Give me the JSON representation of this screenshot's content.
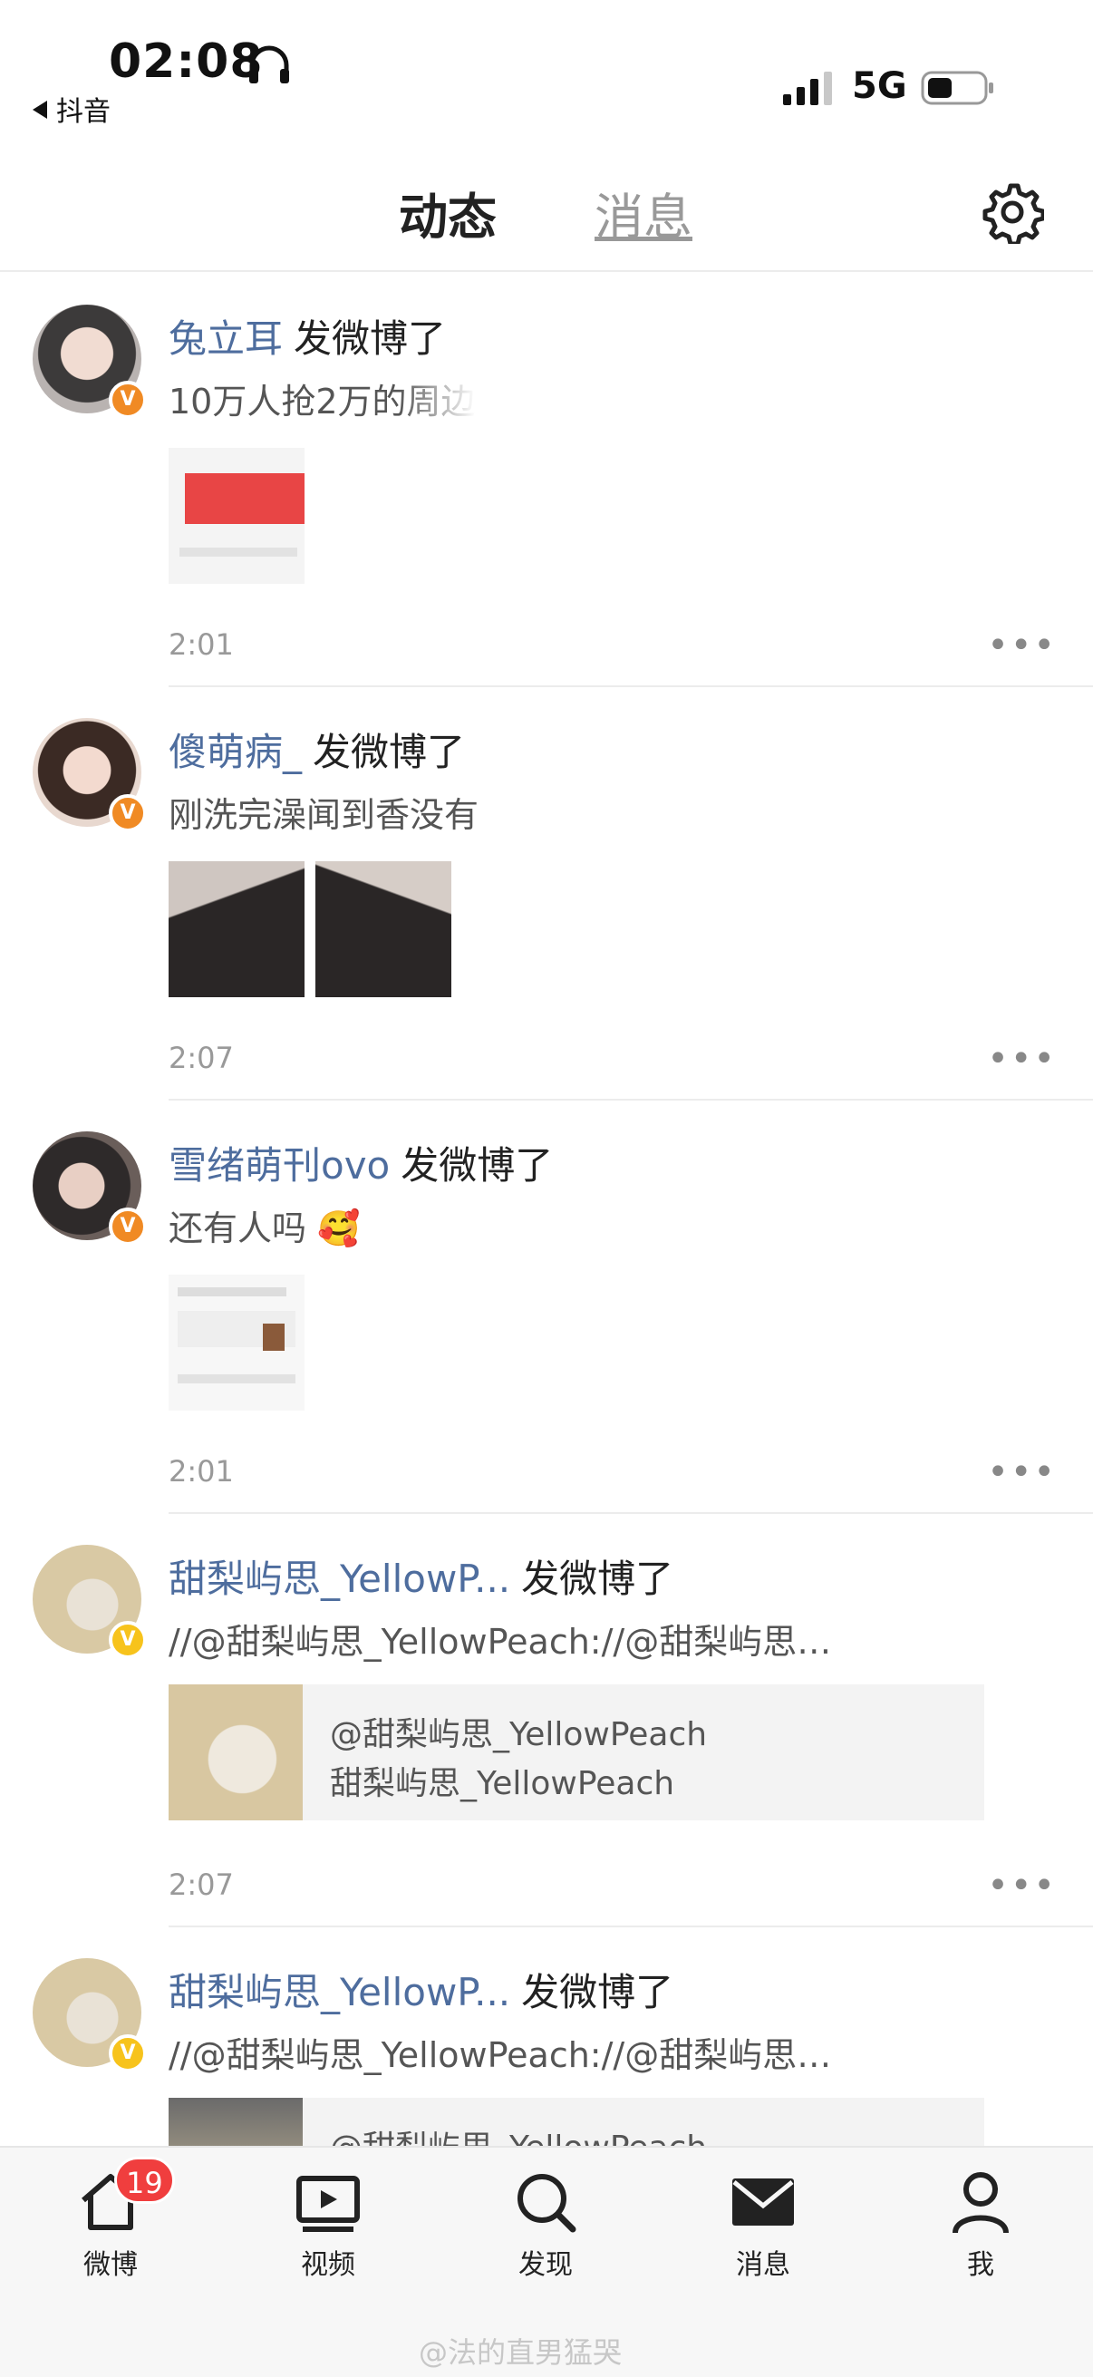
{
  "status_bar": {
    "time": "02:08",
    "back_app": "抖音",
    "network": "5G"
  },
  "top_tabs": {
    "active": "动态",
    "inactive": "消息"
  },
  "feed": [
    {
      "username": "兔立耳",
      "action": "发微博了",
      "text": "10万人抢2万的周边",
      "time": "2:01",
      "badge_color": "#f08a24",
      "media": "1 image"
    },
    {
      "username": "傻萌病_",
      "action": "发微博了",
      "text": "刚洗完澡闻到香没有",
      "time": "2:07",
      "badge_color": "#f08a24",
      "media": "2 images"
    },
    {
      "username": "雪绪萌刊ovo",
      "action": "发微博了",
      "text": "还有人吗 🥰",
      "time": "2:01",
      "badge_color": "#f08a24",
      "media": "1 image"
    },
    {
      "username": "甜梨屿思_YellowP...",
      "action": "发微博了",
      "text": "//@甜梨屿思_YellowPeach://@甜梨屿思…",
      "time": "2:07",
      "badge_color": "#f7c31c",
      "repost_line1": "@甜梨屿思_YellowPeach",
      "repost_line2": "甜梨屿思_YellowPeach"
    },
    {
      "username": "甜梨屿思_YellowP...",
      "action": "发微博了",
      "text": "//@甜梨屿思_YellowPeach://@甜梨屿思…",
      "badge_color": "#f7c31c",
      "repost_line1": "@甜梨屿思_YellowPeach"
    }
  ],
  "bottom_nav": {
    "weibo": "微博",
    "weibo_badge": "19",
    "video": "视频",
    "discover": "发现",
    "messages": "消息",
    "me": "我"
  },
  "watermark": "@法的直男猛哭",
  "colors": {
    "username": "#4e6d9e",
    "tab_underline": "#f5a623",
    "badge_red": "#f03e3e"
  }
}
